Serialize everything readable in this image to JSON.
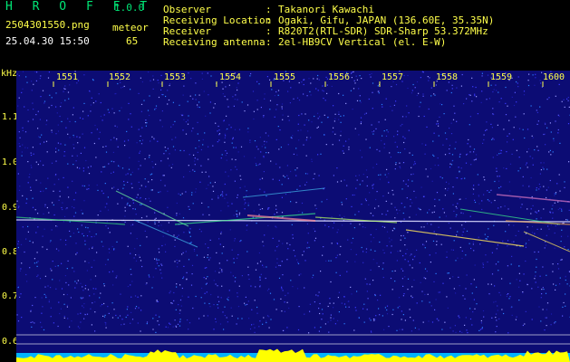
{
  "app": {
    "title": "H R O F F T",
    "version": "1.0.0"
  },
  "file": {
    "name": "2504301550.png",
    "datetime": "25.04.30 15:50"
  },
  "counter": {
    "label": "meteor",
    "value": "65"
  },
  "info": [
    {
      "key": "Observer",
      "sep": ":",
      "value": "Takanori Kawachi"
    },
    {
      "key": "Receiving Location",
      "sep": ":",
      "value": "Ogaki, Gifu, JAPAN (136.60E, 35.35N)"
    },
    {
      "key": "Receiver",
      "sep": ":",
      "value": "R820T2(RTL-SDR) SDR-Sharp 53.372MHz"
    },
    {
      "key": "Receiving antenna",
      "sep": ":",
      "value": "2el-HB9CV Vertical (el. E-W)"
    }
  ],
  "axis": {
    "y_unit": "kHz",
    "y_ticks": [
      "1.1",
      "1.0",
      "0.9",
      "0.8",
      "0.7",
      "0.6"
    ],
    "x_ticks": [
      "1551",
      "1552",
      "1553",
      "1554",
      "1555",
      "1556",
      "1557",
      "1558",
      "1559",
      "1600"
    ]
  },
  "colors": {
    "background": "#000000",
    "noise": "#14148c",
    "label": "#ffff4a",
    "logo": "#00e676",
    "signal_line": "#e8e8ff"
  }
}
